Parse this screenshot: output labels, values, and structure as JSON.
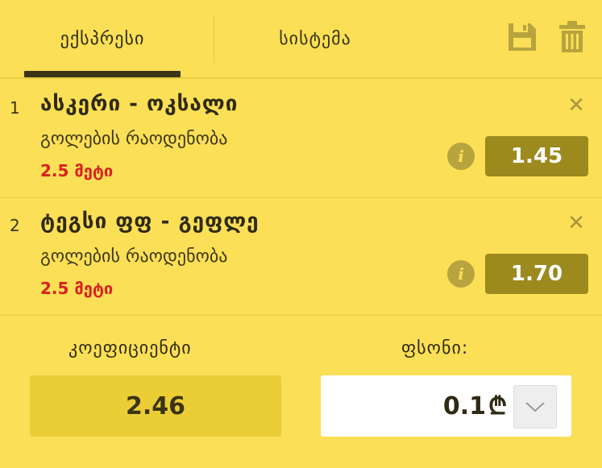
{
  "tabs": {
    "express": "ექსპრესი",
    "system": "სისტემა"
  },
  "toolbar": {
    "save_icon": "save-icon",
    "trash_icon": "trash-icon"
  },
  "bets": [
    {
      "number": "1",
      "match": "ასკერი - ოკსალი",
      "market": "გოლების რაოდენობა",
      "selection": "2.5 მეტი",
      "odds": "1.45"
    },
    {
      "number": "2",
      "match": "ტეგსი ფფ - გეფლე",
      "market": "გოლების რაოდენობა",
      "selection": "2.5 მეტი",
      "odds": "1.70"
    }
  ],
  "footer": {
    "coefficient_label": "კოეფიციენტი",
    "coefficient_value": "2.46",
    "stake_label": "ფსონი:",
    "stake_value": "0.1",
    "currency": "₾"
  },
  "colors": {
    "background": "#fbdf56",
    "odds_box": "#9c8a1f",
    "selection_red": "#d92020",
    "coefficient_box": "#ebce36"
  }
}
